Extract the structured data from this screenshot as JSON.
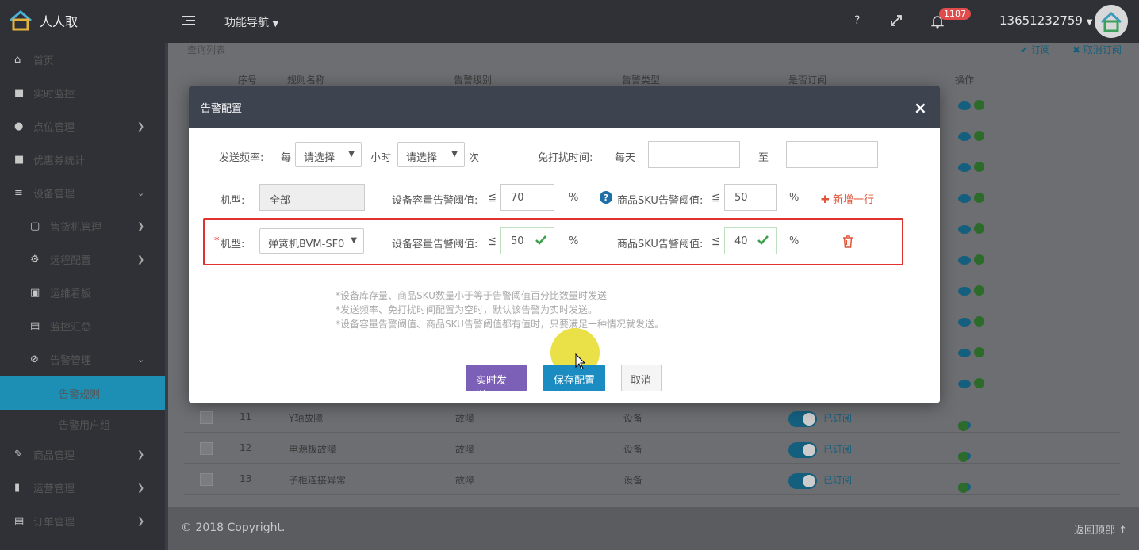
{
  "app": {
    "name": "人人取"
  },
  "topbar": {
    "nav_label": "功能导航",
    "help": "?",
    "notif_count": "1187",
    "user_phone": "13651232759"
  },
  "sidebar": {
    "items": [
      {
        "label": "首页",
        "icon": "home-icon"
      },
      {
        "label": "实时监控",
        "icon": "video-icon"
      },
      {
        "label": "点位管理",
        "icon": "location-icon"
      },
      {
        "label": "优惠券统计",
        "icon": "coupon-icon"
      },
      {
        "label": "设备管理",
        "icon": "device-icon"
      },
      {
        "label": "售货机管理",
        "icon": "vending-icon"
      },
      {
        "label": "远程配置",
        "icon": "cogs-icon"
      },
      {
        "label": "运维看板",
        "icon": "calendar-icon"
      },
      {
        "label": "监控汇总",
        "icon": "file-icon"
      },
      {
        "label": "告警管理",
        "icon": "alarm-icon"
      },
      {
        "label": "告警规则"
      },
      {
        "label": "告警用户组"
      },
      {
        "label": "商品管理",
        "icon": "edit-icon"
      },
      {
        "label": "运营管理",
        "icon": "bookmark-icon"
      },
      {
        "label": "订单管理",
        "icon": "list-icon"
      }
    ]
  },
  "table": {
    "title": "查询列表",
    "actions": {
      "subscribe": "订阅",
      "unsubscribe": "取消订阅"
    },
    "headers": [
      "序号",
      "规则名称",
      "告警级别",
      "告警类型",
      "是否订阅",
      "操作"
    ],
    "rows": [
      {
        "no": "11",
        "name": "Y轴故障",
        "level": "故障",
        "type": "设备",
        "sub": "已订阅"
      },
      {
        "no": "12",
        "name": "电源板故障",
        "level": "故障",
        "type": "设备",
        "sub": "已订阅"
      },
      {
        "no": "13",
        "name": "子柜连接异常",
        "level": "故障",
        "type": "设备",
        "sub": "已订阅"
      }
    ]
  },
  "footer": {
    "copyright": "© 2018 Copyright.",
    "back_top": "返回顶部"
  },
  "modal": {
    "title": "告警配置",
    "close": "×",
    "freq_label": "发送频率:",
    "every": "每",
    "freq_select1": "请选择",
    "hour": "小时",
    "freq_select2": "请选择",
    "times": "次",
    "dnd_label": "免打扰时间:",
    "daily": "每天",
    "to": "至",
    "row1": {
      "model_label": "机型:",
      "model_value": "全部",
      "cap_label": "设备容量告警阈值:",
      "le": "≦",
      "cap_value": "70",
      "pct": "%",
      "sku_label": "商品SKU告警阈值:",
      "sku_value": "50",
      "add_row": "新增一行"
    },
    "row2": {
      "required": "*",
      "model_label": "机型:",
      "model_value": "弹簧机BVM-SF0",
      "cap_label": "设备容量告警阈值:",
      "le": "≦",
      "cap_value": "50",
      "pct": "%",
      "sku_label": "商品SKU告警阈值:",
      "sku_value": "40"
    },
    "notes": [
      "*设备库存量、商品SKU数量小于等于告警阈值百分比数量时发送",
      "*发送频率、免打扰时间配置为空时，默认该告警为实时发送。",
      "*设备容量告警阈值、商品SKU告警阈值都有值时，只要满足一种情况就发送。"
    ],
    "btn_realtime": "实时发送",
    "btn_save": "保存配置",
    "btn_cancel": "取消"
  }
}
